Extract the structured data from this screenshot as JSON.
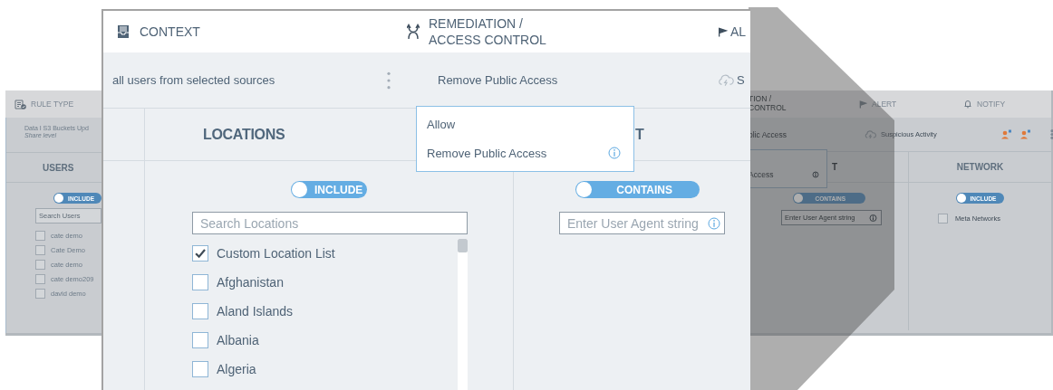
{
  "background_window": {
    "rule_type": {
      "label": "RULE TYPE"
    },
    "rule": {
      "title": "Data I S3 Buckets Upd",
      "subtitle": "Share level"
    },
    "users_column": {
      "heading": "USERS",
      "toggle": {
        "label": "INCLUDE",
        "on": true
      },
      "search": {
        "placeholder": "Search Users"
      },
      "items": [
        {
          "label": "cate demo",
          "checked": false
        },
        {
          "label": "Cate Demo",
          "checked": false
        },
        {
          "label": "cate demo",
          "checked": false
        },
        {
          "label": "cate demo209",
          "checked": false
        },
        {
          "label": "david demo",
          "checked": false
        }
      ]
    },
    "remediation": {
      "label": "TION / CONTROL",
      "value": "blic Access"
    },
    "remediation_menu": {
      "items": [
        {
          "label": "Access",
          "info": true
        }
      ]
    },
    "alert": {
      "label": "ALERT",
      "value": "Suspicious Activity"
    },
    "notify": {
      "label": "NOTIFY"
    },
    "user_agent_column": {
      "heading": "T",
      "toggle": {
        "label": "CONTAINS",
        "on": true
      },
      "field": {
        "placeholder": "Enter User Agent string"
      }
    },
    "network_column": {
      "heading": "NETWORK",
      "toggle": {
        "label": "INCLUDE",
        "on": true
      },
      "items": [
        {
          "label": "Meta Networks",
          "checked": false
        }
      ]
    }
  },
  "zoomed_panel": {
    "context": {
      "label": "CONTEXT",
      "value": "all users from selected sources"
    },
    "remediation": {
      "label": "REMEDIATION / ACCESS CONTROL",
      "value": "Remove Public Access"
    },
    "alert": {
      "label": "AL",
      "value": "S"
    },
    "remediation_menu": {
      "items": [
        {
          "label": "Allow",
          "info": false
        },
        {
          "label": "Remove Public Access",
          "info": true
        }
      ]
    },
    "locations_column": {
      "heading": "LOCATIONS",
      "toggle": {
        "label": "INCLUDE",
        "on": true
      },
      "search": {
        "placeholder": "Search Locations"
      },
      "items": [
        {
          "label": "Custom Location List",
          "checked": true
        },
        {
          "label": "Afghanistan",
          "checked": false
        },
        {
          "label": "Aland Islands",
          "checked": false
        },
        {
          "label": "Albania",
          "checked": false
        },
        {
          "label": "Algeria",
          "checked": false
        }
      ]
    },
    "user_agent_column": {
      "heading": "T",
      "toggle": {
        "label": "CONTAINS",
        "on": true
      },
      "field": {
        "placeholder": "Enter User Agent string"
      }
    }
  }
}
